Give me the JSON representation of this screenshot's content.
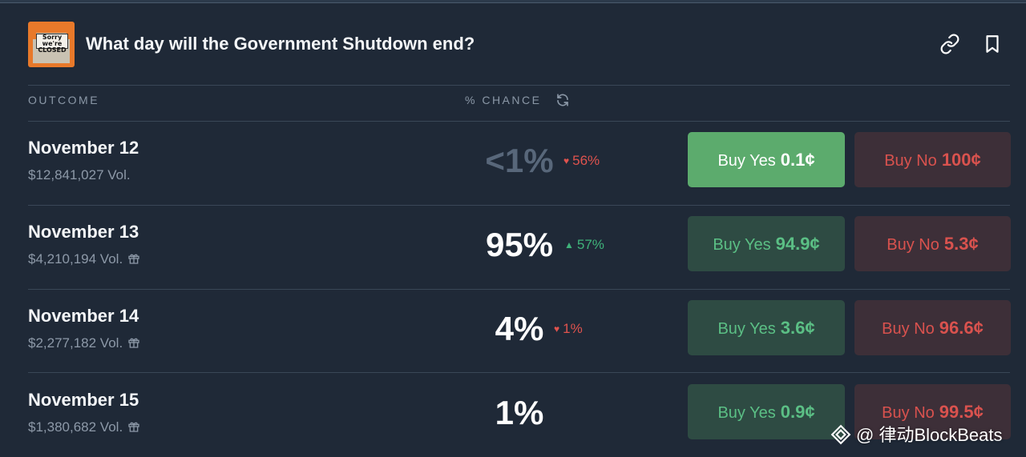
{
  "market": {
    "title": "What day will the Government Shutdown end?",
    "thumbnail_text": "Sorry we're CLOSED"
  },
  "header_icons": [
    "link-icon",
    "bookmark-icon"
  ],
  "columns": {
    "outcome": "OUTCOME",
    "chance": "% CHANCE",
    "chance_icon": "refresh-icon"
  },
  "outcomes": [
    {
      "date": "November 12",
      "volume": "$12,841,027 Vol.",
      "gift": false,
      "chance": "<1%",
      "change": "56%",
      "change_direction": "down",
      "buy_yes_label": "Buy Yes",
      "buy_yes_price": "0.1¢",
      "buy_no_label": "Buy No",
      "buy_no_price": "100¢"
    },
    {
      "date": "November 13",
      "volume": "$4,210,194 Vol.",
      "gift": true,
      "chance": "95%",
      "change": "57%",
      "change_direction": "up",
      "buy_yes_label": "Buy Yes",
      "buy_yes_price": "94.9¢",
      "buy_no_label": "Buy No",
      "buy_no_price": "5.3¢"
    },
    {
      "date": "November 14",
      "volume": "$2,277,182 Vol.",
      "gift": true,
      "chance": "4%",
      "change": "1%",
      "change_direction": "down",
      "buy_yes_label": "Buy Yes",
      "buy_yes_price": "3.6¢",
      "buy_no_label": "Buy No",
      "buy_no_price": "96.6¢"
    },
    {
      "date": "November 15",
      "volume": "$1,380,682 Vol.",
      "gift": true,
      "chance": "1%",
      "change": "",
      "change_direction": "",
      "buy_yes_label": "Buy Yes",
      "buy_yes_price": "0.9¢",
      "buy_no_label": "Buy No",
      "buy_no_price": "99.5¢"
    }
  ],
  "colors": {
    "background": "#1f2937",
    "yes_green": "#5cab6d",
    "no_red": "#d9524e",
    "up": "#3fb37a",
    "down": "#e0534e"
  },
  "watermark": "@ 律动BlockBeats"
}
